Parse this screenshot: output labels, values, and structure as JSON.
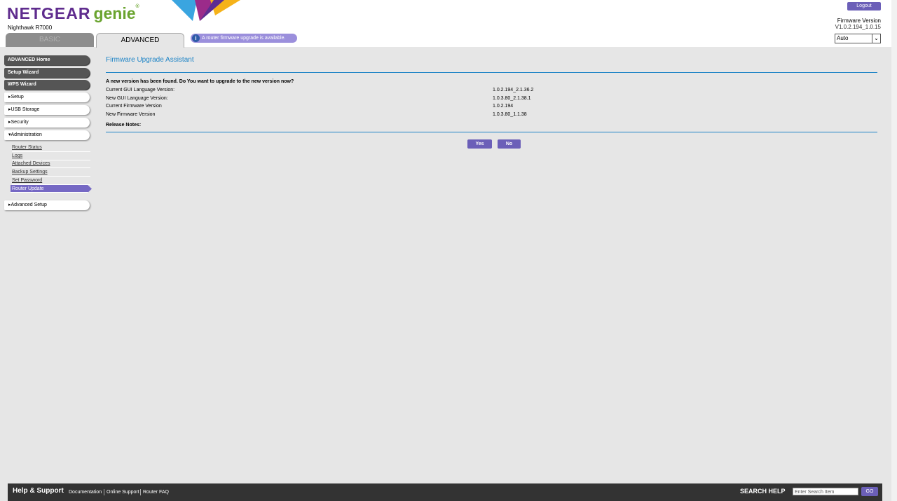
{
  "brand": {
    "name": "NETGEAR",
    "product": "genie",
    "trademark": "®",
    "model": "Nighthawk R7000"
  },
  "tabs": {
    "basic": "BASIC",
    "advanced": "ADVANCED"
  },
  "notice": "A router firmware upgrade is available.",
  "header": {
    "logout": "Logout",
    "firmware_label": "Firmware Version",
    "firmware_value": "V1.0.2.194_1.0.15",
    "language": "Auto"
  },
  "sidebar": {
    "advanced_home": "ADVANCED Home",
    "setup_wizard": "Setup Wizard",
    "wps_wizard": "WPS Wizard",
    "setup": "Setup",
    "usb_storage": "USB Storage",
    "security": "Security",
    "administration": "Administration",
    "admin_items": [
      "Router Status",
      "Logs",
      "Attached Devices",
      "Backup Settings",
      "Set Password",
      "Router Update"
    ],
    "advanced_setup": "Advanced Setup"
  },
  "main": {
    "title": "Firmware Upgrade Assistant",
    "question": "A new version has been found. Do You want to upgrade to the new version now?",
    "rows": [
      {
        "label": "Current GUI Language Version:",
        "value": "1.0.2.194_2.1.36.2"
      },
      {
        "label": "New GUI Language Version:",
        "value": "1.0.3.80_2.1.38.1"
      },
      {
        "label": "Current Firmware Version",
        "value": "1.0.2.194"
      },
      {
        "label": "New Firmware Version",
        "value": "1.0.3.80_1.1.38"
      }
    ],
    "release_notes": "Release Notes:",
    "yes": "Yes",
    "no": "No"
  },
  "footer": {
    "title": "Help & Support",
    "links": [
      "Documentation",
      "Online Support",
      "Router FAQ"
    ],
    "search_label": "SEARCH HELP",
    "search_placeholder": "Enter Search Item",
    "go": "GO"
  },
  "colors": {
    "brand_purple": "#5f2c8e",
    "accent": "#6b5fb8",
    "title_blue": "#1e84c6"
  }
}
